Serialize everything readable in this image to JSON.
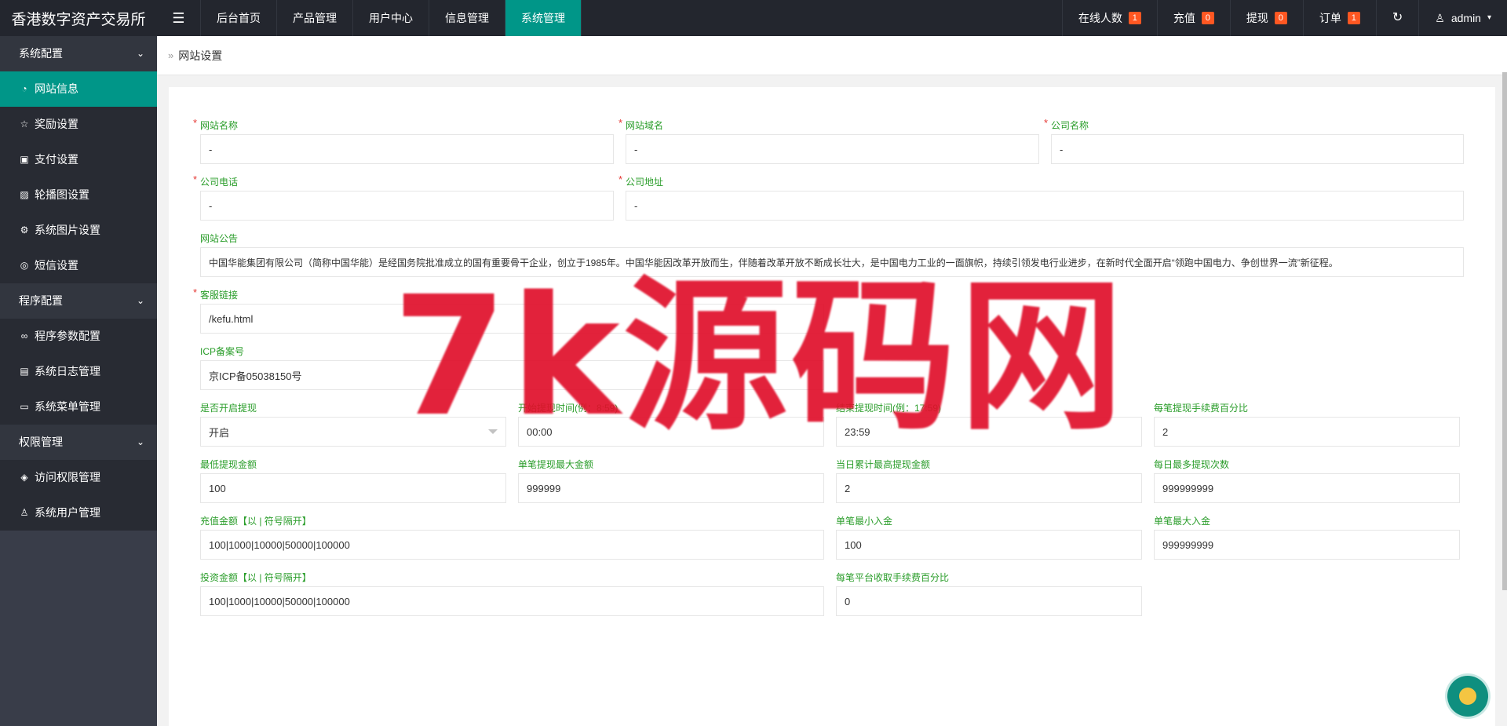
{
  "header": {
    "logo": "香港数字资产交易所",
    "nav": [
      "后台首页",
      "产品管理",
      "用户中心",
      "信息管理",
      "系统管理"
    ],
    "active_nav": "系统管理",
    "right": [
      {
        "label": "在线人数",
        "badge": "1"
      },
      {
        "label": "充值",
        "badge": "0"
      },
      {
        "label": "提现",
        "badge": "0"
      },
      {
        "label": "订单",
        "badge": "1"
      }
    ],
    "user": "admin"
  },
  "sidebar": {
    "groups": [
      {
        "label": "系统配置",
        "items": [
          {
            "label": "网站信息",
            "icon": "dashboard-icon",
            "glyph": "◔"
          },
          {
            "label": "奖励设置",
            "icon": "star-icon",
            "glyph": "☆"
          },
          {
            "label": "支付设置",
            "icon": "money-icon",
            "glyph": "▣"
          },
          {
            "label": "轮播图设置",
            "icon": "image-icon",
            "glyph": "▨"
          },
          {
            "label": "系统图片设置",
            "icon": "gear-icon",
            "glyph": "⚙"
          },
          {
            "label": "短信设置",
            "icon": "chat-icon",
            "glyph": "◎"
          }
        ]
      },
      {
        "label": "程序配置",
        "items": [
          {
            "label": "程序参数配置",
            "icon": "link-icon",
            "glyph": "∞"
          },
          {
            "label": "系统日志管理",
            "icon": "log-icon",
            "glyph": "▤"
          },
          {
            "label": "系统菜单管理",
            "icon": "menu-icon",
            "glyph": "▭"
          }
        ]
      },
      {
        "label": "权限管理",
        "items": [
          {
            "label": "访问权限管理",
            "icon": "shield-icon",
            "glyph": "◈"
          },
          {
            "label": "系统用户管理",
            "icon": "user-icon",
            "glyph": "♙"
          }
        ]
      }
    ],
    "active_item": "网站信息"
  },
  "breadcrumb": "网站设置",
  "form": {
    "site_name": {
      "label": "网站名称",
      "value": "-"
    },
    "site_domain": {
      "label": "网站域名",
      "value": "-"
    },
    "company_name": {
      "label": "公司名称",
      "value": "-"
    },
    "company_phone": {
      "label": "公司电话",
      "value": "-"
    },
    "company_address": {
      "label": "公司地址",
      "value": "-"
    },
    "notice": {
      "label": "网站公告",
      "value": "中国华能集团有限公司（简称中国华能）是经国务院批准成立的国有重要骨干企业，创立于1985年。中国华能因改革开放而生，伴随着改革开放不断成长壮大，是中国电力工业的一面旗帜，持续引领发电行业进步，在新时代全面开启“领跑中国电力、争创世界一流”新征程。"
    },
    "service_link": {
      "label": "客服链接",
      "value": "/kefu.html"
    },
    "icp": {
      "label": "ICP备案号",
      "value": "京ICP备05038150号"
    },
    "withdraw_open": {
      "label": "是否开启提现",
      "value": "开启"
    },
    "withdraw_start": {
      "label": "开始提现时间(例：8:59)",
      "value": "00:00"
    },
    "withdraw_end": {
      "label": "结束提现时间(例：17:59)",
      "value": "23:59"
    },
    "withdraw_fee": {
      "label": "每笔提现手续费百分比",
      "value": "2"
    },
    "withdraw_min": {
      "label": "最低提现金额",
      "value": "100"
    },
    "withdraw_max": {
      "label": "单笔提现最大金额",
      "value": "999999"
    },
    "withdraw_daily_max": {
      "label": "当日累计最高提现金额",
      "value": "2"
    },
    "withdraw_daily_count": {
      "label": "每日最多提现次数",
      "value": "999999999"
    },
    "recharge_amounts": {
      "label": "充值金额【以 | 符号隔开】",
      "value": "100|1000|10000|50000|100000"
    },
    "deposit_min": {
      "label": "单笔最小入金",
      "value": "100"
    },
    "deposit_max": {
      "label": "单笔最大入金",
      "value": "999999999"
    },
    "invest_amounts": {
      "label": "投资金额【以 | 符号隔开】",
      "value": "100|1000|10000|50000|100000"
    },
    "platform_fee": {
      "label": "每笔平台收取手续费百分比",
      "value": "0"
    }
  },
  "watermark": "7k源码网",
  "colors": {
    "accent": "#009688",
    "topbar": "#23262e",
    "sidebar": "#393d49",
    "label": "#2a9d2a",
    "badge": "#ff5722"
  }
}
